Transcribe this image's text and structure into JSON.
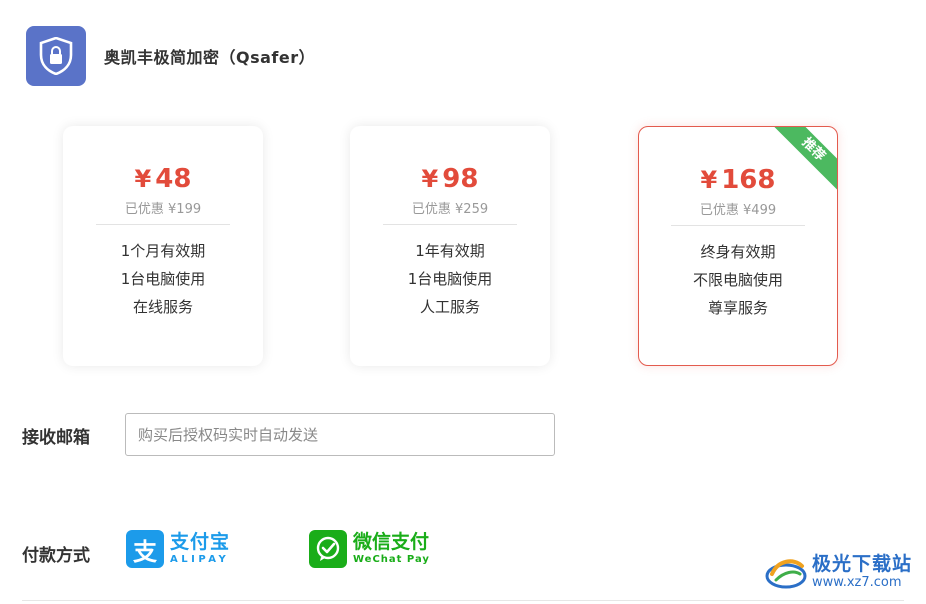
{
  "app": {
    "title": "奥凯丰极简加密（Qsafer）",
    "logo_icon": "shield-lock-icon",
    "logo_color": "#5a73c8"
  },
  "plans": [
    {
      "currency": "¥",
      "price": "48",
      "original": "已优惠 ¥199",
      "features": [
        "1个月有效期",
        "1台电脑使用",
        "在线服务"
      ],
      "featured": false
    },
    {
      "currency": "¥",
      "price": "98",
      "original": "已优惠 ¥259",
      "features": [
        "1年有效期",
        "1台电脑使用",
        "人工服务"
      ],
      "featured": false
    },
    {
      "currency": "¥",
      "price": "168",
      "original": "已优惠 ¥499",
      "features": [
        "终身有效期",
        "不限电脑使用",
        "尊享服务"
      ],
      "featured": true,
      "badge": "推荐"
    }
  ],
  "email": {
    "label": "接收邮箱",
    "placeholder": "购买后授权码实时自动发送",
    "value": ""
  },
  "payment": {
    "label": "付款方式",
    "alipay": {
      "name": "支付宝",
      "en": "ALIPAY",
      "icon": "alipay-icon",
      "color": "#1c9bea"
    },
    "wechat": {
      "name": "微信支付",
      "en": "WeChat Pay",
      "icon": "wechat-pay-icon",
      "color": "#1aad19"
    }
  },
  "watermark": {
    "name": "极光下载站",
    "url": "www.xz7.com"
  },
  "colors": {
    "price_red": "#e24b3b",
    "ribbon_green": "#4cb960"
  }
}
